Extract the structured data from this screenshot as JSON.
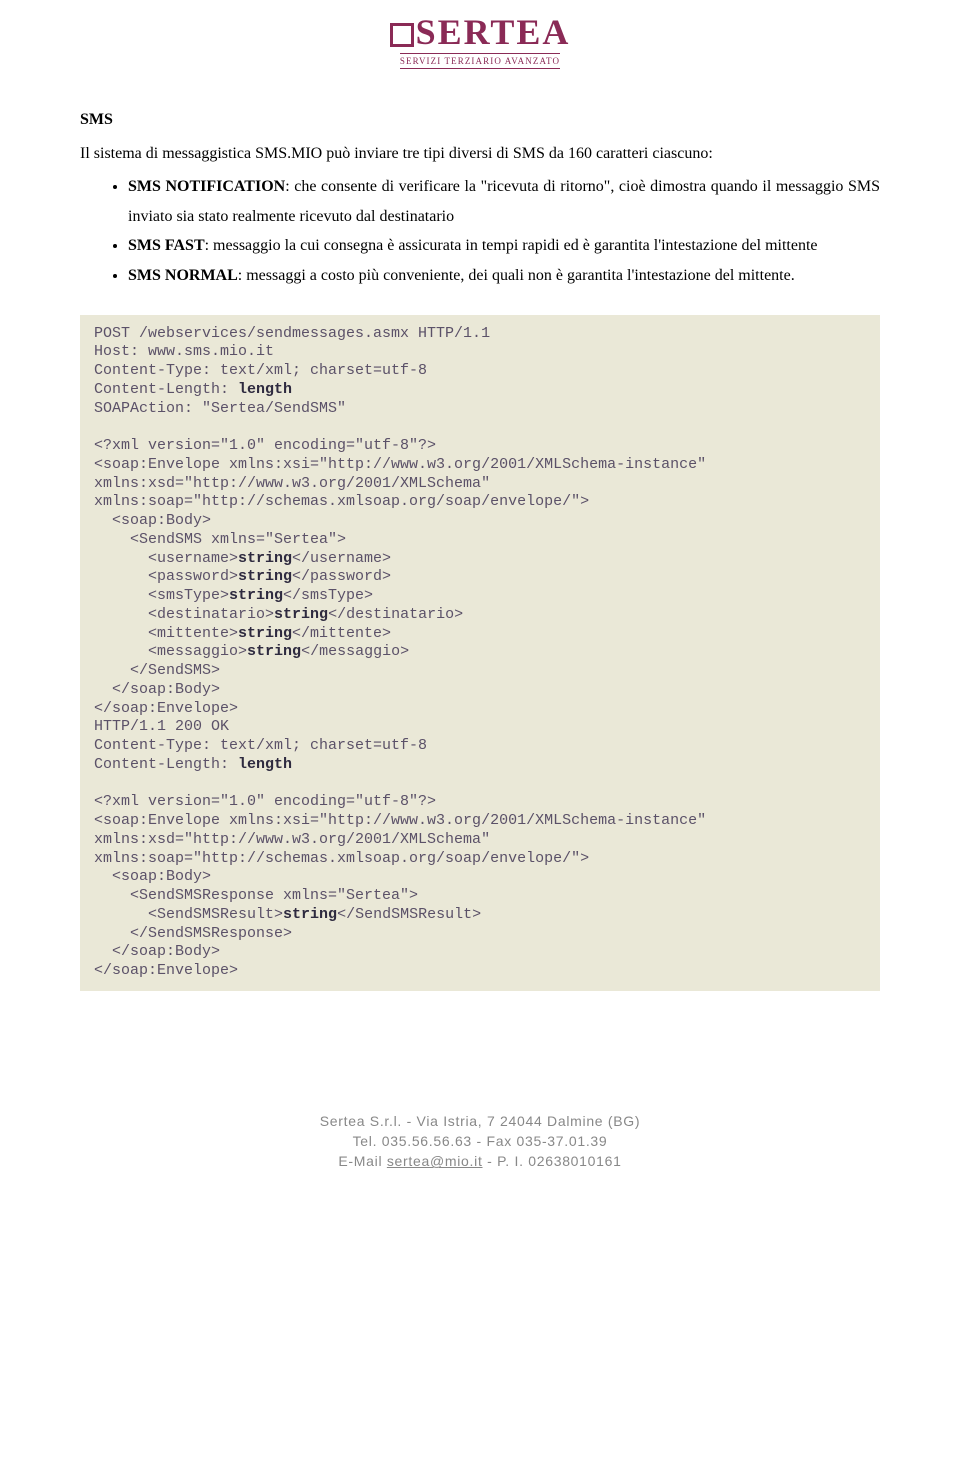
{
  "logo": {
    "main": "SERTEA",
    "sub": "SERVIZI TERZIARIO AVANZATO"
  },
  "section_title": "SMS",
  "intro": "Il sistema di messaggistica SMS.MIO può inviare tre tipi diversi di SMS da 160 caratteri ciascuno:",
  "bullets": [
    {
      "label": "SMS NOTIFICATION",
      "text": ": che consente di verificare la \"ricevuta di ritorno\", cioè dimostra quando il messaggio SMS inviato sia stato realmente ricevuto dal destinatario"
    },
    {
      "label": "SMS FAST",
      "text": ": messaggio la cui consegna è assicurata in tempi rapidi ed è garantita l'intestazione del mittente"
    },
    {
      "label": "SMS NORMAL",
      "text": ": messaggi a costo più conveniente, dei quali non è garantita l'intestazione del mittente."
    }
  ],
  "code": {
    "l01": "POST /webservices/sendmessages.asmx HTTP/1.1",
    "l02": "Host: www.sms.mio.it",
    "l03": "Content-Type: text/xml; charset=utf-8",
    "l04a": "Content-Length: ",
    "l04b": "length",
    "l05": "SOAPAction: \"Sertea/SendSMS\"",
    "l06": "",
    "l07": "<?xml version=\"1.0\" encoding=\"utf-8\"?>",
    "l08": "<soap:Envelope xmlns:xsi=\"http://www.w3.org/2001/XMLSchema-instance\" xmlns:xsd=\"http://www.w3.org/2001/XMLSchema\" xmlns:soap=\"http://schemas.xmlsoap.org/soap/envelope/\">",
    "l09": "  <soap:Body>",
    "l10": "    <SendSMS xmlns=\"Sertea\">",
    "l11a": "      <username>",
    "l11b": "string",
    "l11c": "</username>",
    "l12a": "      <password>",
    "l12b": "string",
    "l12c": "</password>",
    "l13a": "      <smsType>",
    "l13b": "string",
    "l13c": "</smsType>",
    "l14a": "      <destinatario>",
    "l14b": "string",
    "l14c": "</destinatario>",
    "l15a": "      <mittente>",
    "l15b": "string",
    "l15c": "</mittente>",
    "l16a": "      <messaggio>",
    "l16b": "string",
    "l16c": "</messaggio>",
    "l17": "    </SendSMS>",
    "l18": "  </soap:Body>",
    "l19": "</soap:Envelope>",
    "l20": "HTTP/1.1 200 OK",
    "l21": "Content-Type: text/xml; charset=utf-8",
    "l22a": "Content-Length: ",
    "l22b": "length",
    "l23": "",
    "l24": "<?xml version=\"1.0\" encoding=\"utf-8\"?>",
    "l25": "<soap:Envelope xmlns:xsi=\"http://www.w3.org/2001/XMLSchema-instance\" xmlns:xsd=\"http://www.w3.org/2001/XMLSchema\" xmlns:soap=\"http://schemas.xmlsoap.org/soap/envelope/\">",
    "l26": "  <soap:Body>",
    "l27": "    <SendSMSResponse xmlns=\"Sertea\">",
    "l28a": "      <SendSMSResult>",
    "l28b": "string",
    "l28c": "</SendSMSResult>",
    "l29": "    </SendSMSResponse>",
    "l30": "  </soap:Body>",
    "l31": "</soap:Envelope>"
  },
  "footer": {
    "line1": "Sertea S.r.l. - Via Istria, 7 24044 Dalmine (BG)",
    "line2": "Tel. 035.56.56.63 - Fax 035-37.01.39",
    "line3a": "E-Mail ",
    "line3_link": "sertea@mio.it",
    "line3b": " - P. I. 02638010161"
  }
}
